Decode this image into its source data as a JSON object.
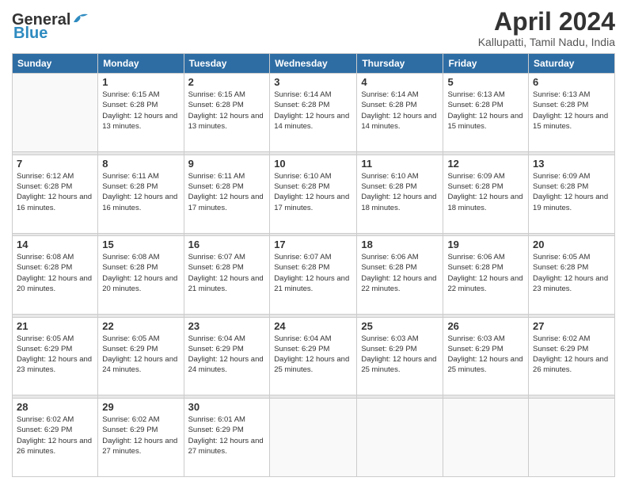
{
  "logo": {
    "line1": "General",
    "line2": "Blue"
  },
  "header": {
    "month_year": "April 2024",
    "location": "Kallupatti, Tamil Nadu, India"
  },
  "weekdays": [
    "Sunday",
    "Monday",
    "Tuesday",
    "Wednesday",
    "Thursday",
    "Friday",
    "Saturday"
  ],
  "weeks": [
    [
      {
        "day": "",
        "sunrise": "",
        "sunset": "",
        "daylight": ""
      },
      {
        "day": "1",
        "sunrise": "Sunrise: 6:15 AM",
        "sunset": "Sunset: 6:28 PM",
        "daylight": "Daylight: 12 hours and 13 minutes."
      },
      {
        "day": "2",
        "sunrise": "Sunrise: 6:15 AM",
        "sunset": "Sunset: 6:28 PM",
        "daylight": "Daylight: 12 hours and 13 minutes."
      },
      {
        "day": "3",
        "sunrise": "Sunrise: 6:14 AM",
        "sunset": "Sunset: 6:28 PM",
        "daylight": "Daylight: 12 hours and 14 minutes."
      },
      {
        "day": "4",
        "sunrise": "Sunrise: 6:14 AM",
        "sunset": "Sunset: 6:28 PM",
        "daylight": "Daylight: 12 hours and 14 minutes."
      },
      {
        "day": "5",
        "sunrise": "Sunrise: 6:13 AM",
        "sunset": "Sunset: 6:28 PM",
        "daylight": "Daylight: 12 hours and 15 minutes."
      },
      {
        "day": "6",
        "sunrise": "Sunrise: 6:13 AM",
        "sunset": "Sunset: 6:28 PM",
        "daylight": "Daylight: 12 hours and 15 minutes."
      }
    ],
    [
      {
        "day": "7",
        "sunrise": "Sunrise: 6:12 AM",
        "sunset": "Sunset: 6:28 PM",
        "daylight": "Daylight: 12 hours and 16 minutes."
      },
      {
        "day": "8",
        "sunrise": "Sunrise: 6:11 AM",
        "sunset": "Sunset: 6:28 PM",
        "daylight": "Daylight: 12 hours and 16 minutes."
      },
      {
        "day": "9",
        "sunrise": "Sunrise: 6:11 AM",
        "sunset": "Sunset: 6:28 PM",
        "daylight": "Daylight: 12 hours and 17 minutes."
      },
      {
        "day": "10",
        "sunrise": "Sunrise: 6:10 AM",
        "sunset": "Sunset: 6:28 PM",
        "daylight": "Daylight: 12 hours and 17 minutes."
      },
      {
        "day": "11",
        "sunrise": "Sunrise: 6:10 AM",
        "sunset": "Sunset: 6:28 PM",
        "daylight": "Daylight: 12 hours and 18 minutes."
      },
      {
        "day": "12",
        "sunrise": "Sunrise: 6:09 AM",
        "sunset": "Sunset: 6:28 PM",
        "daylight": "Daylight: 12 hours and 18 minutes."
      },
      {
        "day": "13",
        "sunrise": "Sunrise: 6:09 AM",
        "sunset": "Sunset: 6:28 PM",
        "daylight": "Daylight: 12 hours and 19 minutes."
      }
    ],
    [
      {
        "day": "14",
        "sunrise": "Sunrise: 6:08 AM",
        "sunset": "Sunset: 6:28 PM",
        "daylight": "Daylight: 12 hours and 20 minutes."
      },
      {
        "day": "15",
        "sunrise": "Sunrise: 6:08 AM",
        "sunset": "Sunset: 6:28 PM",
        "daylight": "Daylight: 12 hours and 20 minutes."
      },
      {
        "day": "16",
        "sunrise": "Sunrise: 6:07 AM",
        "sunset": "Sunset: 6:28 PM",
        "daylight": "Daylight: 12 hours and 21 minutes."
      },
      {
        "day": "17",
        "sunrise": "Sunrise: 6:07 AM",
        "sunset": "Sunset: 6:28 PM",
        "daylight": "Daylight: 12 hours and 21 minutes."
      },
      {
        "day": "18",
        "sunrise": "Sunrise: 6:06 AM",
        "sunset": "Sunset: 6:28 PM",
        "daylight": "Daylight: 12 hours and 22 minutes."
      },
      {
        "day": "19",
        "sunrise": "Sunrise: 6:06 AM",
        "sunset": "Sunset: 6:28 PM",
        "daylight": "Daylight: 12 hours and 22 minutes."
      },
      {
        "day": "20",
        "sunrise": "Sunrise: 6:05 AM",
        "sunset": "Sunset: 6:28 PM",
        "daylight": "Daylight: 12 hours and 23 minutes."
      }
    ],
    [
      {
        "day": "21",
        "sunrise": "Sunrise: 6:05 AM",
        "sunset": "Sunset: 6:29 PM",
        "daylight": "Daylight: 12 hours and 23 minutes."
      },
      {
        "day": "22",
        "sunrise": "Sunrise: 6:05 AM",
        "sunset": "Sunset: 6:29 PM",
        "daylight": "Daylight: 12 hours and 24 minutes."
      },
      {
        "day": "23",
        "sunrise": "Sunrise: 6:04 AM",
        "sunset": "Sunset: 6:29 PM",
        "daylight": "Daylight: 12 hours and 24 minutes."
      },
      {
        "day": "24",
        "sunrise": "Sunrise: 6:04 AM",
        "sunset": "Sunset: 6:29 PM",
        "daylight": "Daylight: 12 hours and 25 minutes."
      },
      {
        "day": "25",
        "sunrise": "Sunrise: 6:03 AM",
        "sunset": "Sunset: 6:29 PM",
        "daylight": "Daylight: 12 hours and 25 minutes."
      },
      {
        "day": "26",
        "sunrise": "Sunrise: 6:03 AM",
        "sunset": "Sunset: 6:29 PM",
        "daylight": "Daylight: 12 hours and 25 minutes."
      },
      {
        "day": "27",
        "sunrise": "Sunrise: 6:02 AM",
        "sunset": "Sunset: 6:29 PM",
        "daylight": "Daylight: 12 hours and 26 minutes."
      }
    ],
    [
      {
        "day": "28",
        "sunrise": "Sunrise: 6:02 AM",
        "sunset": "Sunset: 6:29 PM",
        "daylight": "Daylight: 12 hours and 26 minutes."
      },
      {
        "day": "29",
        "sunrise": "Sunrise: 6:02 AM",
        "sunset": "Sunset: 6:29 PM",
        "daylight": "Daylight: 12 hours and 27 minutes."
      },
      {
        "day": "30",
        "sunrise": "Sunrise: 6:01 AM",
        "sunset": "Sunset: 6:29 PM",
        "daylight": "Daylight: 12 hours and 27 minutes."
      },
      {
        "day": "",
        "sunrise": "",
        "sunset": "",
        "daylight": ""
      },
      {
        "day": "",
        "sunrise": "",
        "sunset": "",
        "daylight": ""
      },
      {
        "day": "",
        "sunrise": "",
        "sunset": "",
        "daylight": ""
      },
      {
        "day": "",
        "sunrise": "",
        "sunset": "",
        "daylight": ""
      }
    ]
  ]
}
